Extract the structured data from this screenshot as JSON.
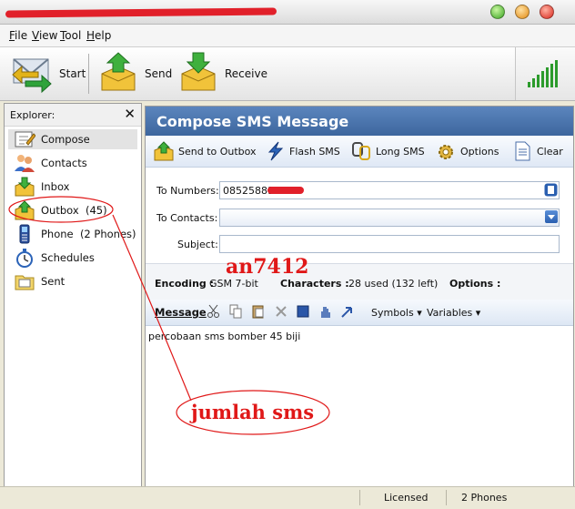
{
  "menu": {
    "file": "File",
    "view": "View",
    "tool": "Tool",
    "help": "Help"
  },
  "toolbar": {
    "start": "Start",
    "send": "Send",
    "receive": "Receive"
  },
  "explorer": {
    "title": "Explorer:",
    "close": "✕",
    "items": [
      {
        "label": "Compose",
        "icon": "compose-icon"
      },
      {
        "label": "Contacts",
        "icon": "contacts-icon"
      },
      {
        "label": "Inbox",
        "icon": "inbox-icon"
      },
      {
        "label": "Outbox",
        "count": "(45)",
        "icon": "outbox-icon"
      },
      {
        "label": "Phone",
        "count": "(2 Phones)",
        "icon": "phone-icon"
      },
      {
        "label": "Schedules",
        "icon": "stopwatch-icon"
      },
      {
        "label": "Sent",
        "icon": "sent-folder-icon"
      }
    ]
  },
  "compose": {
    "title": "Compose SMS Message",
    "actions": {
      "send_to_outbox": "Send to Outbox",
      "flash_sms": "Flash SMS",
      "long_sms": "Long SMS",
      "options": "Options",
      "clear": "Clear"
    },
    "to_numbers_label": "To Numbers:",
    "to_numbers_value": "08525881",
    "to_contacts_label": "To Contacts:",
    "to_contacts_value": "",
    "subject_label": "Subject:",
    "subject_value": "",
    "encoding_label": "Encoding :",
    "encoding_value": "GSM 7-bit",
    "characters_label": "Characters :",
    "characters_value": "28 used (132 left)",
    "options_label": "Options :",
    "message_label": "Message",
    "symbols_label": "Symbols",
    "variables_label": "Variables",
    "message_text": "percobaan sms bomber 45 biji"
  },
  "status": {
    "license": "Licensed",
    "phones": "2 Phones"
  },
  "overlay": {
    "watermark": "an7412",
    "annotation": "jumlah sms"
  },
  "colors": {
    "title_blue": "#3d669e",
    "annotation_red": "#e01818"
  }
}
